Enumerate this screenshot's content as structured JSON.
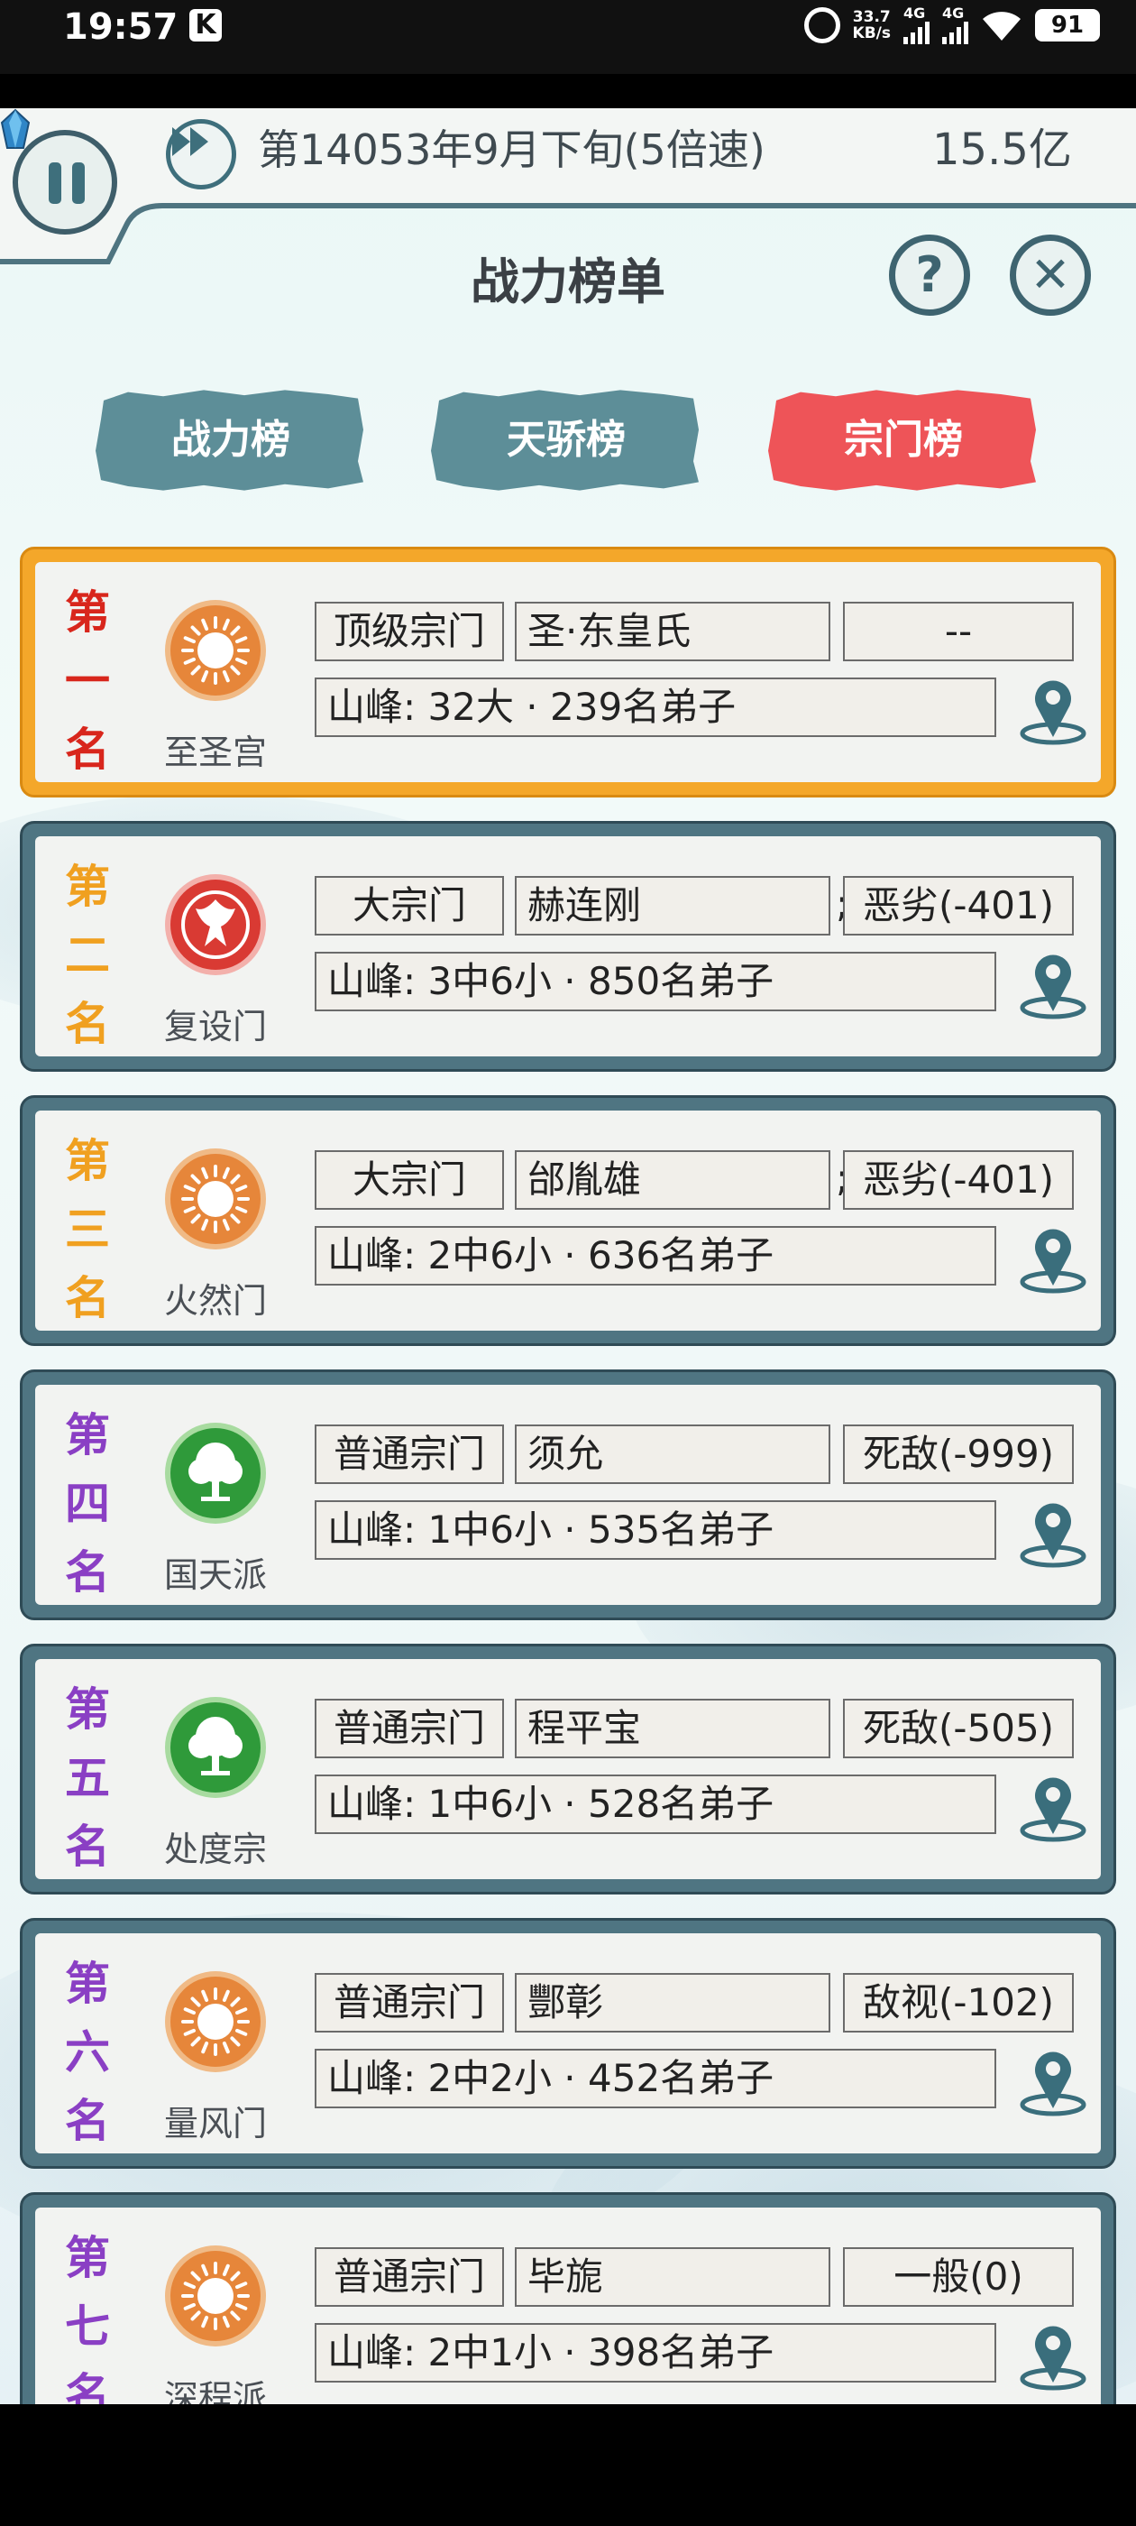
{
  "status_bar": {
    "time": "19:57",
    "app_badge": "K",
    "net_speed_top": "33.7",
    "net_speed_bottom": "KB/s",
    "sim1_label": "4G",
    "sim2_label": "4G",
    "battery": "91"
  },
  "hud": {
    "date_text": "第14053年9月下旬(5倍速)",
    "spirit_stones": "15.5亿"
  },
  "panel": {
    "title": "战力榜单",
    "help_glyph": "?",
    "close_glyph": "✕"
  },
  "tabs": [
    {
      "label": "战力榜",
      "active": false
    },
    {
      "label": "天骄榜",
      "active": false
    },
    {
      "label": "宗门榜",
      "active": true
    }
  ],
  "entries": [
    {
      "rank": [
        "第",
        "一",
        "名"
      ],
      "rank_color": "#d8261c",
      "emblem": "sun-emblem",
      "name": "至圣宫",
      "grade": "顶级宗门",
      "master": "圣·东皇氏",
      "relation": "--",
      "mountains": "山峰: 32大 · 239名弟子",
      "semicolon": ""
    },
    {
      "rank": [
        "第",
        "二",
        "名"
      ],
      "rank_color": "#f0a020",
      "emblem": "phoenix-emblem",
      "name": "复设门",
      "grade": "大宗门",
      "master": "赫连刚",
      "relation": "恶劣(-401)",
      "mountains": "山峰: 3中6小 · 850名弟子",
      "semicolon": ";"
    },
    {
      "rank": [
        "第",
        "三",
        "名"
      ],
      "rank_color": "#f0a020",
      "emblem": "sun-emblem",
      "name": "火然门",
      "grade": "大宗门",
      "master": "邰胤雄",
      "relation": "恶劣(-401)",
      "mountains": "山峰: 2中6小 · 636名弟子",
      "semicolon": ";"
    },
    {
      "rank": [
        "第",
        "四",
        "名"
      ],
      "rank_color": "#8a3fc4",
      "emblem": "tree-emblem",
      "name": "国天派",
      "grade": "普通宗门",
      "master": "须允",
      "relation": "死敌(-999)",
      "mountains": "山峰: 1中6小 · 535名弟子",
      "semicolon": ""
    },
    {
      "rank": [
        "第",
        "五",
        "名"
      ],
      "rank_color": "#8a3fc4",
      "emblem": "tree-emblem",
      "name": "处度宗",
      "grade": "普通宗门",
      "master": "程平宝",
      "relation": "死敌(-505)",
      "mountains": "山峰: 1中6小 · 528名弟子",
      "semicolon": ""
    },
    {
      "rank": [
        "第",
        "六",
        "名"
      ],
      "rank_color": "#8a3fc4",
      "emblem": "sun-emblem",
      "name": "量风门",
      "grade": "普通宗门",
      "master": "酆彰",
      "relation": "敌视(-102)",
      "mountains": "山峰: 2中2小 · 452名弟子",
      "semicolon": ""
    },
    {
      "rank": [
        "第",
        "七",
        "名"
      ],
      "rank_color": "#8a3fc4",
      "emblem": "sun-emblem",
      "name": "深程派",
      "grade": "普通宗门",
      "master": "毕旎",
      "relation": "一般(0)",
      "mountains": "山峰: 2中1小 · 398名弟子",
      "semicolon": ""
    }
  ]
}
